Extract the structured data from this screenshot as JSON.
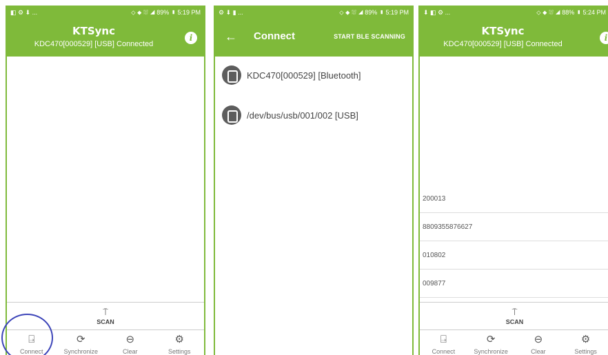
{
  "status_bar": {
    "screen1": {
      "left": "◧ ⚙ ⬇ ...",
      "right": "⬦ ⬥ ⛆ ◢ 89% ▮ 5:19 PM"
    },
    "screen2": {
      "left": "⚙ ⬇ ▮ ...",
      "right": "⬦ ⬥ ⛆ ◢ 89% ▮ 5:19 PM"
    },
    "screen3": {
      "left": "⬇ ◧ ⚙ ...",
      "right": "⬦ ⬥ ⛆ ◢ 88% ▮ 5:24 PM"
    }
  },
  "app": {
    "title": "KTSync",
    "subtitle": "KDC470[000529] [USB] Connected",
    "info_icon": "i"
  },
  "connect_screen": {
    "back_icon": "←",
    "title": "Connect",
    "scan_ble": "START BLE SCANNING",
    "devices": [
      {
        "label": "KDC470[000529] [Bluetooth]",
        "icon": "device-icon"
      },
      {
        "label": "/dev/bus/usb/001/002 [USB]",
        "icon": "device-icon"
      }
    ]
  },
  "scan": {
    "label": "SCAN",
    "icon": "⍑"
  },
  "nav": [
    {
      "label": "Connect",
      "icon": "⍈"
    },
    {
      "label": "Synchronize",
      "icon": "⟳"
    },
    {
      "label": "Clear",
      "icon": "⊖"
    },
    {
      "label": "Settings",
      "icon": "⚙"
    }
  ],
  "barcode_list": [
    "200013",
    "8809355876627",
    "010802",
    "009877"
  ],
  "colors": {
    "app_bar": "#7fba3a",
    "highlight_circle": "#3b43b8"
  }
}
